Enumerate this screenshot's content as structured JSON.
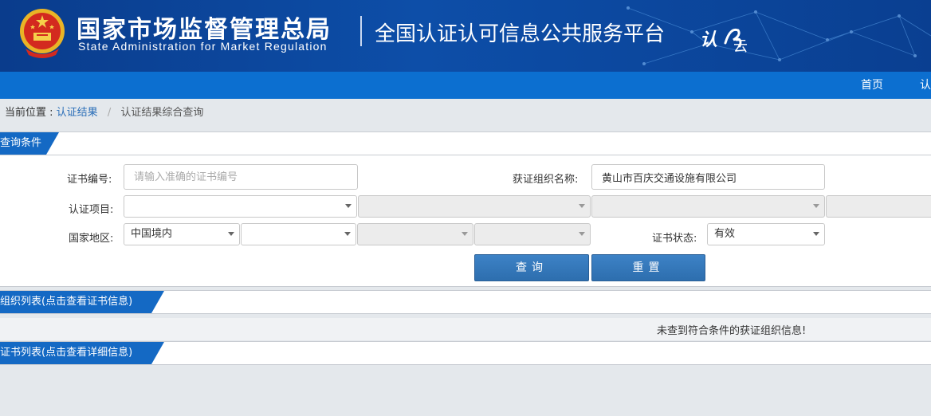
{
  "header": {
    "org_cn": "国家市场监督管理总局",
    "org_en": "State Administration  for  Market Regulation",
    "platform": "全国认证认可信息公共服务平台",
    "logo_text_1": "认",
    "logo_text_2": "云"
  },
  "nav": {
    "items": [
      {
        "label": "首页"
      },
      {
        "label": "认"
      }
    ]
  },
  "breadcrumb": {
    "label": "当前位置 : ",
    "link": "认证结果",
    "separator": "/",
    "current": "认证结果综合查询"
  },
  "query_section": {
    "title": "查询条件",
    "cert_no_label": "证书编号:",
    "cert_no_placeholder": "请输入准确的证书编号",
    "org_name_label": "获证组织名称:",
    "org_name_value": "黄山市百庆交通设施有限公司",
    "project_label": "认证项目:",
    "region_label": "国家地区:",
    "region_value": "中国境内",
    "status_label": "证书状态:",
    "status_value": "有效",
    "search_label": "查询",
    "reset_label": "重置"
  },
  "org_list": {
    "title": "组织列表(点击查看证书信息)",
    "empty_message": "未查到符合条件的获证组织信息!"
  },
  "cert_list": {
    "title": "证书列表(点击查看详细信息)"
  },
  "colors": {
    "header_bg": "#0d4ea8",
    "nav_bg": "#0c6fd0",
    "tab_bg": "#1469c4",
    "button": "#3476ba",
    "link": "#2a6eb8"
  }
}
